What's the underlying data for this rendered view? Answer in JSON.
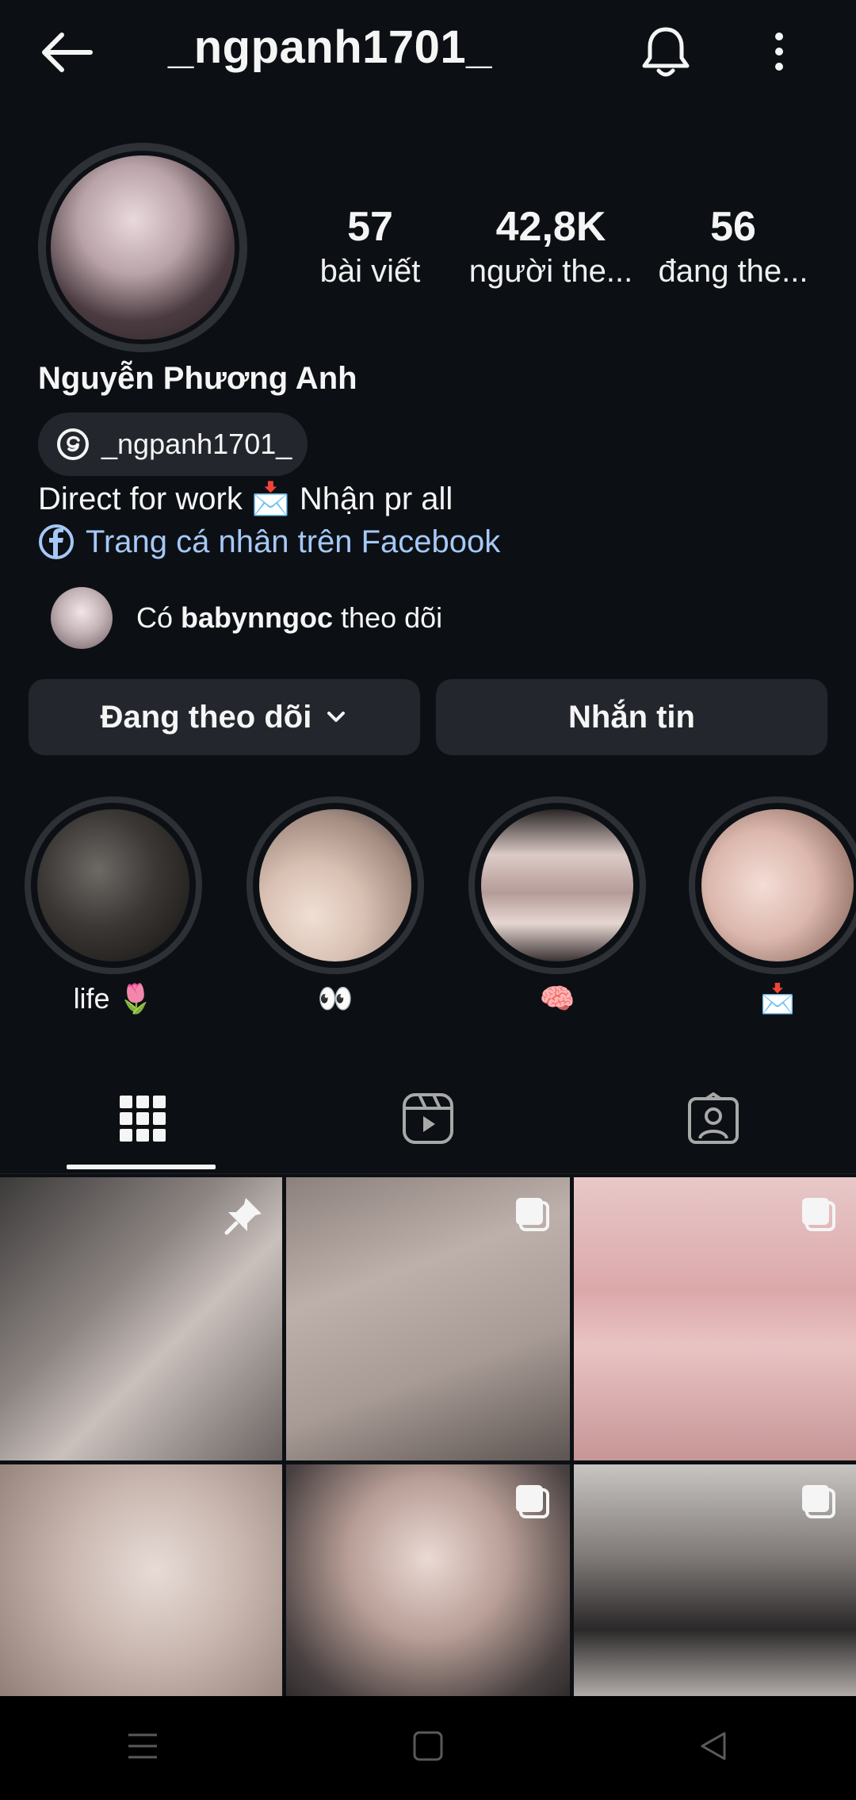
{
  "header": {
    "username": "_ngpanh1701_",
    "back_icon": "arrow-left-icon",
    "bell_icon": "bell-icon",
    "more_icon": "more-vertical-icon"
  },
  "profile": {
    "display_name": "Nguyễn Phương Anh",
    "threads_handle": "_ngpanh1701_",
    "bio": "Direct for work 📩 Nhận pr all",
    "facebook_link": "Trang cá nhân trên Facebook",
    "followed_by": {
      "prefix": "Có ",
      "user": "babynngoc",
      "suffix": " theo dõi"
    }
  },
  "stats": [
    {
      "number": "57",
      "label": "bài viết"
    },
    {
      "number": "42,8K",
      "label": "người the..."
    },
    {
      "number": "56",
      "label": "đang the..."
    }
  ],
  "actions": {
    "following_label": "Đang theo dõi",
    "message_label": "Nhắn tin"
  },
  "highlights": [
    {
      "label": "life 🌷"
    },
    {
      "label": "👀"
    },
    {
      "label": "🧠"
    },
    {
      "label": "📩"
    }
  ],
  "tabs": [
    {
      "name": "posts",
      "icon": "grid-icon",
      "active": true
    },
    {
      "name": "reels",
      "icon": "reels-icon",
      "active": false
    },
    {
      "name": "tagged",
      "icon": "tagged-user-icon",
      "active": false
    }
  ],
  "posts": [
    {
      "badge": "pin-icon"
    },
    {
      "badge": "carousel-icon"
    },
    {
      "badge": "carousel-icon"
    },
    {
      "badge": ""
    },
    {
      "badge": "carousel-icon"
    },
    {
      "badge": "carousel-icon"
    }
  ],
  "colors": {
    "background": "#0c1014",
    "button": "#23272d",
    "link": "#a5c8f7"
  }
}
